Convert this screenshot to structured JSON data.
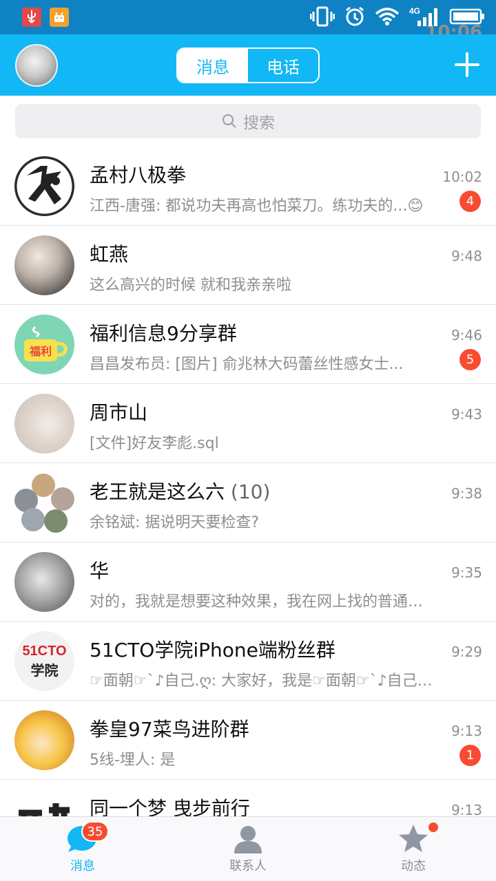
{
  "status_bar": {
    "time": "10:06",
    "network": "4G"
  },
  "header": {
    "tabs": [
      {
        "label": "消息",
        "active": true
      },
      {
        "label": "电话",
        "active": false
      }
    ]
  },
  "search": {
    "placeholder": "搜索"
  },
  "conversations": [
    {
      "name": "孟村八极拳",
      "count": "",
      "message": "江西-唐强: 都说功夫再高也怕菜刀。练功夫的...😊",
      "time": "10:02",
      "unread": "4",
      "avatar_icon": "kungfu-logo"
    },
    {
      "name": "虹燕",
      "count": "",
      "message": "这么高兴的时候 就和我亲亲啦",
      "time": "9:48",
      "unread": "",
      "avatar_icon": "photo"
    },
    {
      "name": "福利信息9分享群",
      "count": "",
      "message": "昌昌发布员: [图片] 俞兆林大码蕾丝性感女士...",
      "time": "9:46",
      "unread": "5",
      "avatar_icon": "welfare-cup"
    },
    {
      "name": "周市山",
      "count": "",
      "message": "[文件]好友李彪.sql",
      "time": "9:43",
      "unread": "",
      "avatar_icon": "photo"
    },
    {
      "name": "老王就是这么六",
      "count": "(10)",
      "message": "余铭斌: 据说明天要检查?",
      "time": "9:38",
      "unread": "",
      "avatar_icon": "group-collage"
    },
    {
      "name": "华",
      "count": "",
      "message": "对的，我就是想要这种效果，我在网上找的普通的...",
      "time": "9:35",
      "unread": "",
      "avatar_icon": "photo"
    },
    {
      "name": "51CTO学院iPhone端粉丝群",
      "count": "",
      "message": "☞面朝☞`♪自己.ღ: 大家好，我是☞面朝☞`♪自己.ღ...",
      "time": "9:29",
      "unread": "",
      "avatar_icon": "51cto-logo",
      "avatar_text": [
        "51CTO",
        "学院"
      ]
    },
    {
      "name": "拳皇97菜鸟进阶群",
      "count": "",
      "message": "5线-埋人: 是",
      "time": "9:13",
      "unread": "1",
      "avatar_icon": "anime-face"
    },
    {
      "name": "同一个梦 曳步前行",
      "count": "",
      "message": "",
      "time": "9:13",
      "unread": "",
      "avatar_icon": "calligraphy"
    }
  ],
  "tab_bar": [
    {
      "label": "消息",
      "badge": "35",
      "icon": "chat-bubble-icon",
      "active": true
    },
    {
      "label": "联系人",
      "badge": "",
      "icon": "person-icon",
      "active": false
    },
    {
      "label": "动态",
      "badge": "dot",
      "icon": "star-icon",
      "active": false
    }
  ],
  "colors": {
    "brand": "#12b7f5",
    "status_bar": "#0f82c4",
    "badge": "#f74c31"
  }
}
